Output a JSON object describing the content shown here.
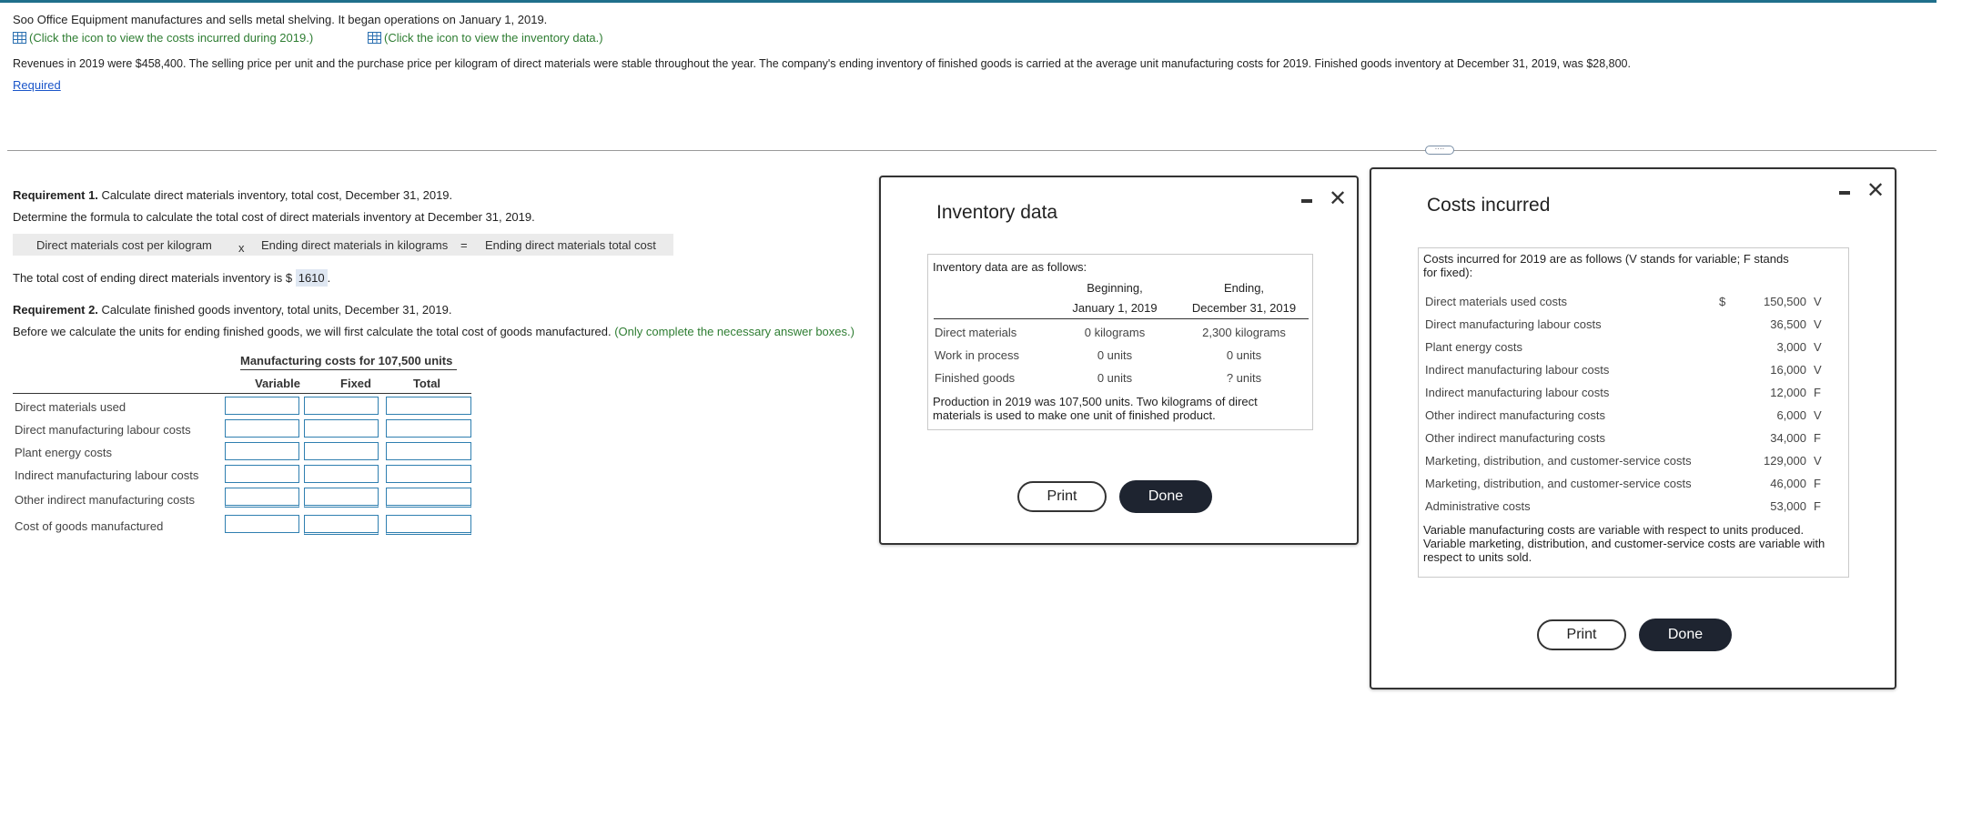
{
  "intro": {
    "company_text": "Soo Office Equipment manufactures and sells metal shelving. It began operations on January 1, 2019.",
    "costs_link": "(Click the icon to view the costs incurred during 2019.)",
    "inventory_link": "(Click the icon to view the inventory data.)",
    "revenue_text": "Revenues in 2019 were $458,400. The selling price per unit and the purchase price per kilogram of direct materials were stable throughout the year. The company's ending inventory of finished goods is carried at the average unit manufacturing costs for 2019. Finished goods inventory at December 31, 2019, was $28,800.",
    "required_link": "Required"
  },
  "req1": {
    "label": "Requirement 1.",
    "text": " Calculate direct materials inventory, total cost, December 31, 2019.",
    "formula_prompt": "Determine the formula to calculate the total cost of direct materials inventory at December 31, 2019.",
    "formula": {
      "term1": "Direct materials cost per kilogram",
      "op1": "x",
      "term2": "Ending direct materials in kilograms",
      "op2": "=",
      "result": "Ending direct materials total cost"
    },
    "total_prefix": "The total cost of ending direct materials inventory is $",
    "total_value": "1610",
    "total_suffix": "."
  },
  "req2": {
    "label": "Requirement 2.",
    "text": " Calculate finished goods inventory, total units, December 31, 2019.",
    "note": "Before we calculate the units for ending finished goods, we will first calculate the total cost of goods manufactured.",
    "hint": "(Only complete the necessary answer boxes.)",
    "table": {
      "title": "Manufacturing costs for 107,500 units",
      "col_variable": "Variable",
      "col_fixed": "Fixed",
      "col_total": "Total",
      "rows": [
        "Direct materials used",
        "Direct manufacturing labour costs",
        "Plant energy costs",
        "Indirect manufacturing labour costs",
        "Other indirect manufacturing costs",
        "Cost of goods manufactured"
      ]
    }
  },
  "inventory_modal": {
    "title": "Inventory data",
    "intro": "Inventory data are as follows:",
    "col_begin_1": "Beginning,",
    "col_begin_2": "January 1, 2019",
    "col_end_1": "Ending,",
    "col_end_2": "December 31, 2019",
    "rows": [
      {
        "label": "Direct materials",
        "begin": "0 kilograms",
        "end": "2,300 kilograms"
      },
      {
        "label": "Work in process",
        "begin": "0 units",
        "end": "0 units"
      },
      {
        "label": "Finished goods",
        "begin": "0 units",
        "end": "? units"
      }
    ],
    "footnote_1": "Production in 2019 was 107,500 units. Two kilograms of direct",
    "footnote_2": "materials is used to make one unit of finished product.",
    "print": "Print",
    "done": "Done"
  },
  "costs_modal": {
    "title": "Costs incurred",
    "intro_1": "Costs incurred for 2019 are as follows (V stands for variable; F stands",
    "intro_2": "for fixed):",
    "currency": "$",
    "rows": [
      {
        "label": "Direct materials used costs",
        "amount": "150,500",
        "type": "V"
      },
      {
        "label": "Direct manufacturing labour costs",
        "amount": "36,500",
        "type": "V"
      },
      {
        "label": "Plant energy costs",
        "amount": "3,000",
        "type": "V"
      },
      {
        "label": "Indirect manufacturing labour costs",
        "amount": "16,000",
        "type": "V"
      },
      {
        "label": "Indirect manufacturing labour costs",
        "amount": "12,000",
        "type": "F"
      },
      {
        "label": "Other indirect manufacturing costs",
        "amount": "6,000",
        "type": "V"
      },
      {
        "label": "Other indirect manufacturing costs",
        "amount": "34,000",
        "type": "F"
      },
      {
        "label": "Marketing, distribution, and customer-service costs",
        "amount": "129,000",
        "type": "V"
      },
      {
        "label": "Marketing, distribution, and customer-service costs",
        "amount": "46,000",
        "type": "F"
      },
      {
        "label": "Administrative costs",
        "amount": "53,000",
        "type": "F"
      }
    ],
    "footnote_1": "Variable manufacturing costs are variable with respect to units produced.",
    "footnote_2": "Variable marketing, distribution, and customer-service costs are variable with",
    "footnote_3": "respect to units sold.",
    "print": "Print",
    "done": "Done"
  },
  "colors": {
    "accent_bar": "#1f6f8b",
    "hint_green": "#2e7d32",
    "link_blue": "#1a55c9",
    "input_border": "#2f7fb0",
    "done_button": "#1e2430"
  }
}
